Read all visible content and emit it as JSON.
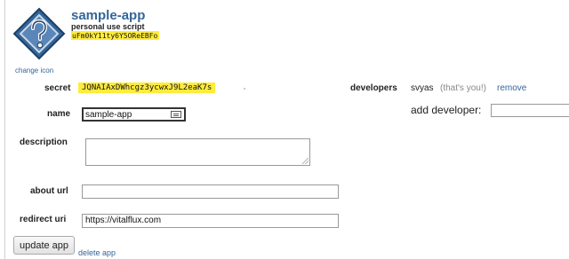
{
  "app": {
    "title": "sample-app",
    "type": "personal use script",
    "client_id": "uFm0kY11ty6Y5OReEBFo",
    "change_icon": "change icon",
    "icon": "question-mark-icon"
  },
  "secret": {
    "label": "secret",
    "value": "JQNAIAxDWhcgz3ycwxJ9L2eaK7s"
  },
  "developers": {
    "label": "developers",
    "name": "svyas",
    "note": "(that's you!)",
    "remove": "remove",
    "add_label": "add developer:",
    "add_value": ""
  },
  "form": {
    "name_label": "name",
    "name_value": "sample-app",
    "description_label": "description",
    "description_value": "",
    "about_url_label": "about url",
    "about_url_value": "",
    "redirect_uri_label": "redirect uri",
    "redirect_uri_value": "https://vitalflux.com"
  },
  "actions": {
    "update": "update app",
    "delete": "delete app"
  },
  "colors": {
    "highlight": "#ffec3d",
    "link": "#336699",
    "icon_fill": "#336699"
  }
}
